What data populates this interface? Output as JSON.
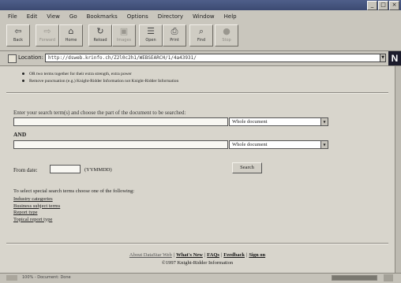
{
  "window": {
    "minimize": "_",
    "maximize": "□",
    "close": "×"
  },
  "menubar": {
    "items": [
      "File",
      "Edit",
      "View",
      "Go",
      "Bookmarks",
      "Options",
      "Directory",
      "Window",
      "Help"
    ]
  },
  "toolbar": {
    "buttons": [
      {
        "label": "Back",
        "icon": "back-arrow-icon",
        "glyph": "⇦"
      },
      {
        "label": "Forward",
        "icon": "forward-arrow-icon",
        "glyph": "⇨"
      },
      {
        "label": "Home",
        "icon": "home-icon",
        "glyph": "⌂"
      },
      {
        "label": "Reload",
        "icon": "reload-icon",
        "glyph": "↻"
      },
      {
        "label": "Images",
        "icon": "images-icon",
        "glyph": "▣"
      },
      {
        "label": "Open",
        "icon": "open-icon",
        "glyph": "☰"
      },
      {
        "label": "Print",
        "icon": "print-icon",
        "glyph": "⎙"
      },
      {
        "label": "Find",
        "icon": "find-icon",
        "glyph": "⌕"
      },
      {
        "label": "Stop",
        "icon": "stop-icon",
        "glyph": "●"
      }
    ]
  },
  "location": {
    "label": "Location:",
    "url": "http://dsweb.krinfo.ch/Z2l0c2h1/WEBSEARCH/1/4a43931/"
  },
  "logo": {
    "text": "N"
  },
  "tips": [
    "OR two terms together for their extra strength, extra power",
    "Remove punctuation (e.g.) Knight-Ridder Information not Knight-Ridder Information"
  ],
  "form": {
    "instruction": "Enter your search term(s) and choose the part of the document to be searched:",
    "select1": "Whole document",
    "and_label": "AND",
    "select2": "Whole document",
    "from_date_label": "From date:",
    "date_format": "(YYMMDD)",
    "search_button": "Search"
  },
  "special": {
    "intro": "To select special search terms choose one of the following:",
    "links": [
      "Industry categories",
      "Business subject terms",
      "Report type",
      "Topical report type"
    ]
  },
  "footer": {
    "links": [
      "About DataStar Web",
      "What's New",
      "FAQs",
      "Feedback",
      "Sign on"
    ],
    "copyright": "©1997 Knight-Ridder Information"
  },
  "status": {
    "text": "100% - Document: Done",
    "progress": 1.0
  }
}
